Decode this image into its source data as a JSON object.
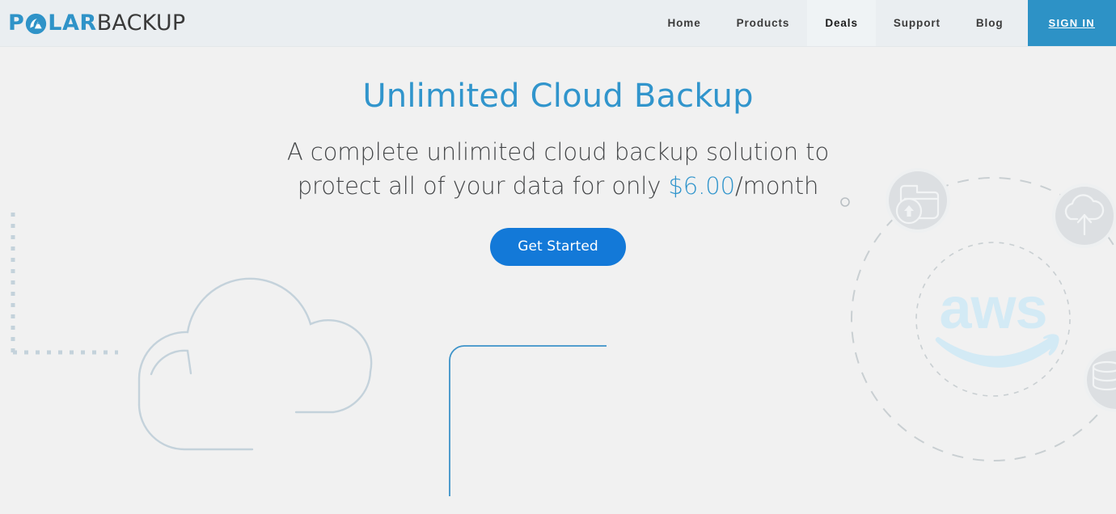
{
  "brand": {
    "name_primary": "P",
    "name_primary_rest": "LAR",
    "name_secondary": "BACKUP",
    "mark_icon": "polar-bear-mountain-circle-icon",
    "accent_color": "#2f93c8"
  },
  "nav": {
    "items": [
      {
        "label": "Home",
        "active": false
      },
      {
        "label": "Products",
        "active": false
      },
      {
        "label": "Deals",
        "active": true
      },
      {
        "label": "Support",
        "active": false
      },
      {
        "label": "Blog",
        "active": false
      }
    ],
    "signin_label": "SIGN IN",
    "signin_color": "#2d92c6"
  },
  "hero": {
    "title": "Unlimited Cloud Backup",
    "title_color": "#3195cc",
    "subtitle_line1": "A complete unlimited cloud backup solution to",
    "subtitle_line2_before": "protect all of your data for only ",
    "subtitle_price": "$6.00",
    "subtitle_line2_after": "/month",
    "price_color": "#3195cc",
    "cta_label": "Get Started",
    "cta_color": "#1379d8"
  },
  "artwork": {
    "aws_wordmark": "aws",
    "aws_color": "#d3eaf5",
    "cloud_outline_color": "#c4d2db",
    "dotted_line_color": "#c4d2db",
    "blue_corner_color": "#3d93c9",
    "dashed_ring_color": "#c9cfd2",
    "badge_fill": "#dcdfe2",
    "badges": [
      {
        "icon": "folder-upload-icon",
        "position": "top-left"
      },
      {
        "icon": "cloud-upload-icon",
        "position": "top-right"
      },
      {
        "icon": "database-icon",
        "position": "bottom-right"
      }
    ]
  }
}
